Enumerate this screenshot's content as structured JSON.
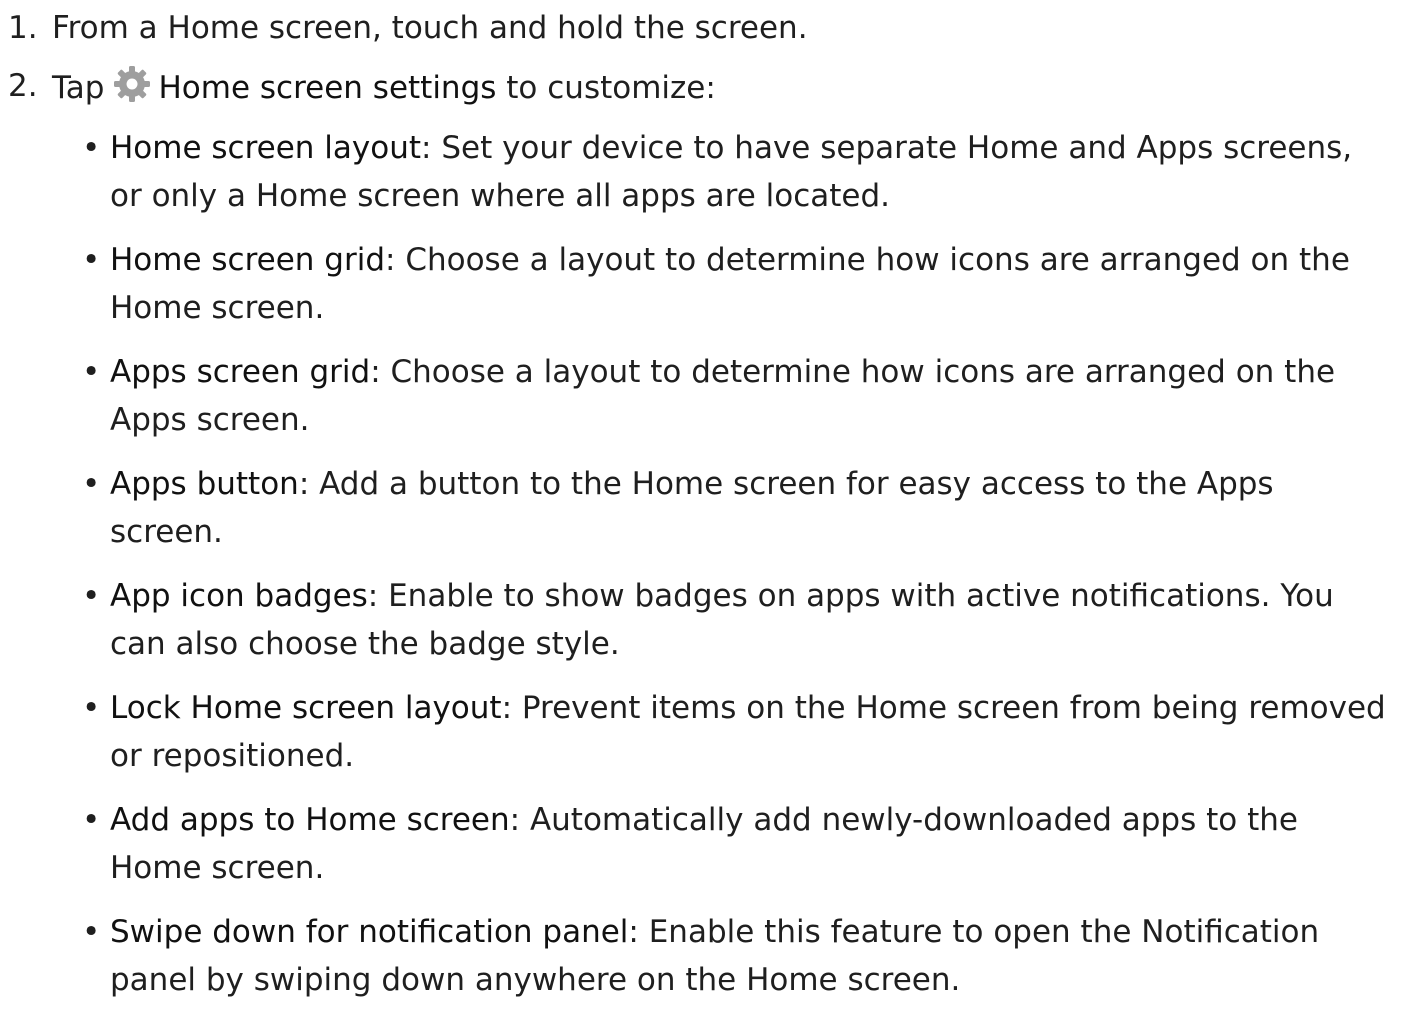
{
  "steps": [
    {
      "number": "1.",
      "text": "From a Home screen, touch and hold the screen."
    },
    {
      "number": "2.",
      "prefix": "Tap",
      "icon": "gear-icon",
      "term": "Home screen settings",
      "suffix": " to customize:"
    }
  ],
  "bullets": [
    {
      "term": "Home screen layout",
      "text": ": Set your device to have separate Home and Apps screens, or only a Home screen where all apps are located."
    },
    {
      "term": "Home screen grid",
      "text": ": Choose a layout to determine how icons are arranged on the Home screen."
    },
    {
      "term": "Apps screen grid",
      "text": ": Choose a layout to determine how icons are arranged on the Apps screen."
    },
    {
      "term": "Apps button",
      "text": ": Add a button to the Home screen for easy access to the Apps screen."
    },
    {
      "term": "App icon badges",
      "text": ": Enable to show badges on apps with active notifications. You can also choose the badge style."
    },
    {
      "term": "Lock Home screen layout",
      "text": ": Prevent items on the Home screen from being removed or repositioned."
    },
    {
      "term": "Add apps to Home screen",
      "text": ": Automatically add newly-downloaded apps to the Home screen."
    },
    {
      "term": "Swipe down for notification panel",
      "text": ": Enable this feature to open the Notification panel by swiping down anywhere on the Home screen."
    }
  ],
  "colors": {
    "text": "#1f1f1f",
    "icon": "#9e9e9e"
  }
}
